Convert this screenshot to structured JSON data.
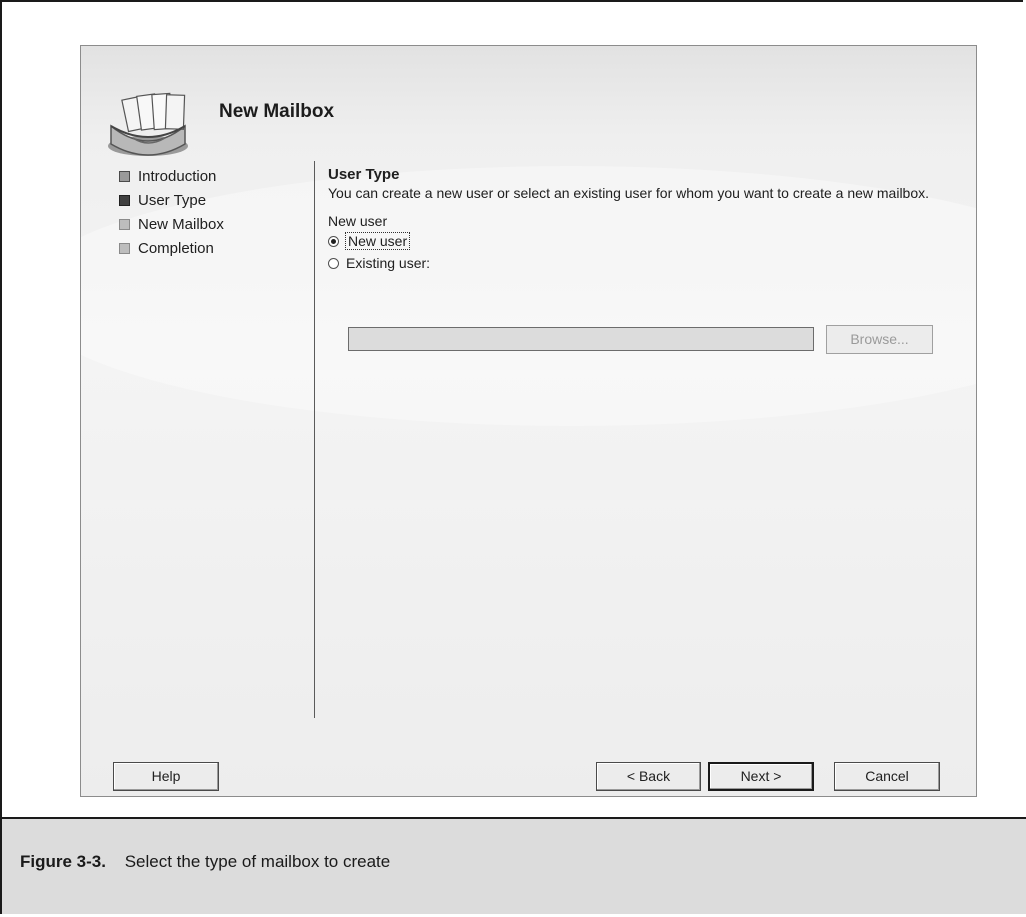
{
  "dialog": {
    "title": "New Mailbox",
    "icon": "mailbox-wizard-icon"
  },
  "nav": {
    "items": [
      {
        "label": "Introduction",
        "state": "done"
      },
      {
        "label": "User Type",
        "state": "current"
      },
      {
        "label": "New Mailbox",
        "state": "pending"
      },
      {
        "label": "Completion",
        "state": "pending"
      }
    ]
  },
  "content": {
    "section_title": "User Type",
    "description": "You can create a new user or select an existing user for whom you want to create a new mailbox.",
    "group_label": "New user",
    "radio_new_user": {
      "label": "New user",
      "checked": true
    },
    "radio_existing_user": {
      "label": "Existing user:",
      "checked": false
    },
    "existing_user_value": "",
    "browse_label": "Browse..."
  },
  "buttons": {
    "help": "Help",
    "back": "< Back",
    "next": "Next >",
    "cancel": "Cancel"
  },
  "caption": {
    "figure_label": "Figure 3-3.",
    "text": "Select the type of mailbox to create"
  }
}
